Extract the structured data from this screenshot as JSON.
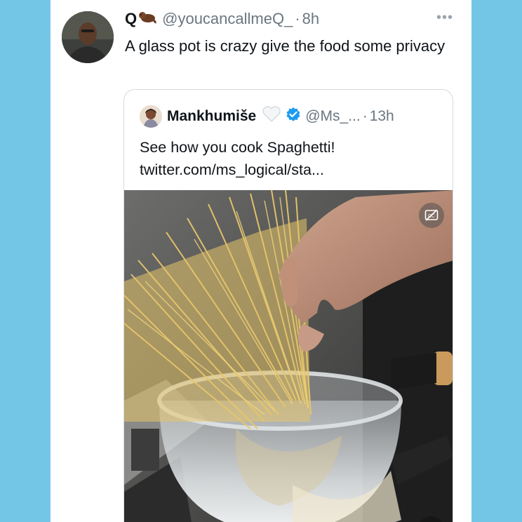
{
  "tweet": {
    "display_name": "Q",
    "handle": "@youcancallmeQ_",
    "separator": "·",
    "time": "8h",
    "more_icon": "more-dots-icon",
    "text": "A glass pot is crazy give the food some privacy"
  },
  "quoted_tweet": {
    "display_name": "Mankhumiše",
    "name_emoji": "white-heart-icon",
    "verified_icon": "verified-badge-icon",
    "handle": "@Ms_...",
    "separator": "·",
    "time": "13h",
    "text": "See how you cook Spaghetti!",
    "link": "twitter.com/ms_logical/sta...",
    "media": {
      "description_icon": "video-thumbnail",
      "captions_icon": "captions-icon",
      "mute_icon": "speaker-muted-icon"
    }
  },
  "colors": {
    "background": "#74c6e6",
    "card": "#ffffff",
    "primary_text": "#0f1419",
    "secondary_text": "#6b7680",
    "verified": "#1d9bf0",
    "border": "#d4dbe0"
  }
}
